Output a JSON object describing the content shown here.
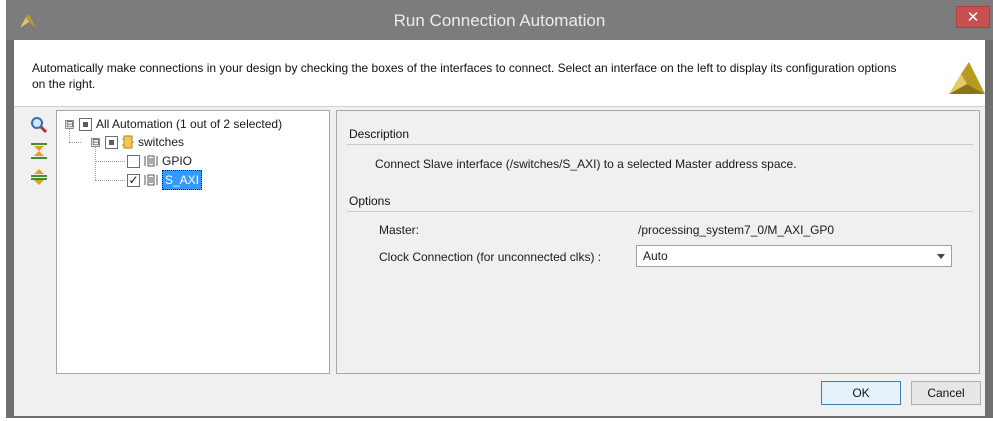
{
  "window": {
    "title": "Run Connection Automation",
    "close_label": "✕"
  },
  "banner": {
    "description": "Automatically make connections in your design by checking the boxes of the interfaces to connect. Select an interface on the left to display its configuration options on the right."
  },
  "toolbar": {
    "icons": [
      "search-icon",
      "collapse-all-icon",
      "expand-all-icon"
    ]
  },
  "tree": {
    "root": {
      "label": "All Automation (1 out of 2 selected)",
      "expander": "⊟",
      "check_state": "partial"
    },
    "group": {
      "label": "switches",
      "expander": "⊟",
      "check_state": "partial"
    },
    "items": [
      {
        "label": "GPIO",
        "checked": false,
        "check_mark": ""
      },
      {
        "label": "S_AXI",
        "checked": true,
        "check_mark": "✓",
        "selected": true
      }
    ]
  },
  "details": {
    "description_heading": "Description",
    "description_text": "Connect Slave interface (/switches/S_AXI) to a selected Master address space.",
    "options_heading": "Options",
    "master_label": "Master:",
    "master_value": "/processing_system7_0/M_AXI_GP0",
    "clock_label": "Clock Connection (for unconnected clks) :",
    "clock_value": "Auto"
  },
  "buttons": {
    "ok": "OK",
    "cancel": "Cancel"
  },
  "colors": {
    "titlebar": "#7c7c7c",
    "close": "#c75050",
    "selection": "#3399ff",
    "xilinx_logo": "#c8a415"
  }
}
